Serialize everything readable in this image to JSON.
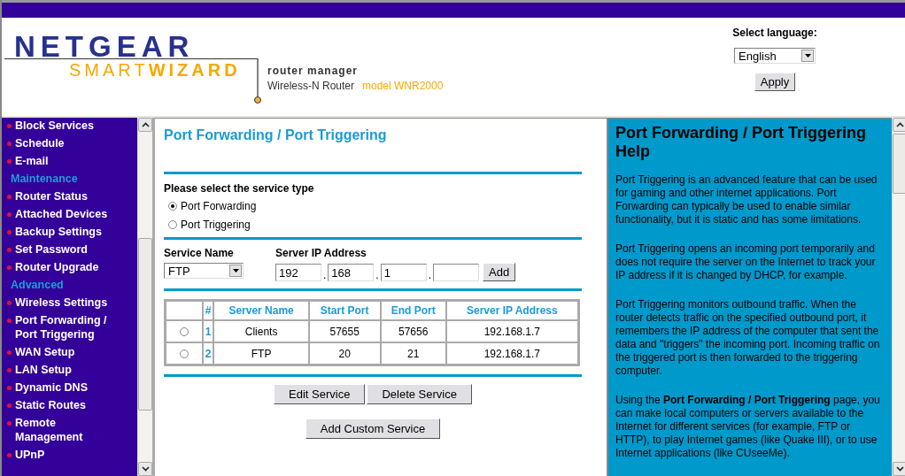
{
  "header": {
    "brand": "NETGEAR",
    "product": "SMART**WIZARD**",
    "tagline": "router manager",
    "device": "Wireless-N Router",
    "model": "model WNR2000",
    "language_label": "Select language:",
    "language": "English",
    "apply": "Apply"
  },
  "sidebar": {
    "items": [
      {
        "kind": "item",
        "label": "Block Services"
      },
      {
        "kind": "item",
        "label": "Schedule"
      },
      {
        "kind": "item",
        "label": "E-mail"
      },
      {
        "kind": "heading",
        "label": "Maintenance"
      },
      {
        "kind": "item",
        "label": "Router Status"
      },
      {
        "kind": "item",
        "label": "Attached Devices"
      },
      {
        "kind": "item",
        "label": "Backup Settings"
      },
      {
        "kind": "item",
        "label": "Set Password"
      },
      {
        "kind": "item",
        "label": "Router Upgrade"
      },
      {
        "kind": "heading",
        "label": "Advanced"
      },
      {
        "kind": "item",
        "label": "Wireless Settings"
      },
      {
        "kind": "item",
        "label": "Port Forwarding / Port Triggering"
      },
      {
        "kind": "item",
        "label": "WAN Setup"
      },
      {
        "kind": "item",
        "label": "LAN Setup"
      },
      {
        "kind": "item",
        "label": "Dynamic DNS"
      },
      {
        "kind": "item",
        "label": "Static Routes"
      },
      {
        "kind": "item",
        "label": "Remote Management"
      },
      {
        "kind": "item",
        "label": "UPnP"
      }
    ]
  },
  "main": {
    "title": "Port Forwarding / Port Triggering",
    "service_type_label": "Please select the service type",
    "service_types": [
      {
        "label": "Port Forwarding",
        "selected": true
      },
      {
        "label": "Port Triggering",
        "selected": false
      }
    ],
    "service_name_label": "Service Name",
    "service_name": "FTP",
    "server_ip_label": "Server IP Address",
    "server_ip": [
      "192",
      "168",
      "1"
    ],
    "ip_separator": ".",
    "add": "Add",
    "table": {
      "columns": [
        "#",
        "Server Name",
        "Start Port",
        "End Port",
        "Server IP Address"
      ],
      "rows": [
        {
          "selected": false,
          "cells": [
            "1",
            "Clients",
            "57655",
            "57656",
            "192.168.1.7"
          ]
        },
        {
          "selected": false,
          "cells": [
            "2",
            "FTP",
            "20",
            "21",
            "192.168.1.7"
          ]
        }
      ]
    },
    "buttons": [
      "Edit Service",
      "Delete Service"
    ],
    "add_custom": "Add Custom Service"
  },
  "help": {
    "title": "Port Forwarding / Port Triggering Help",
    "paragraphs": [
      "Port Triggering is an advanced feature that can be used for gaming and other internet applications. Port Forwarding can typically be used to enable similar functionality, but it is static and has some limitations.",
      "Port Triggering opens an incoming port temporarily and does not require the server on the Internet to track your IP address if it is changed by DHCP, for example.",
      "Port Triggering monitors outbound traffic. When the router detects traffic on the specified outbound port, it remembers the IP address of the computer that sent the data and \"triggers\" the incoming port. Incoming traffic on the triggered port is then forwarded to the triggering computer.",
      "Using the **Port Forwarding / Port Triggering** page, you can make local computers or servers available to the Internet for different services (for example, FTP or HTTP), to play Internet games (like Quake III), or to use Internet applications (like CUseeMe)."
    ]
  }
}
